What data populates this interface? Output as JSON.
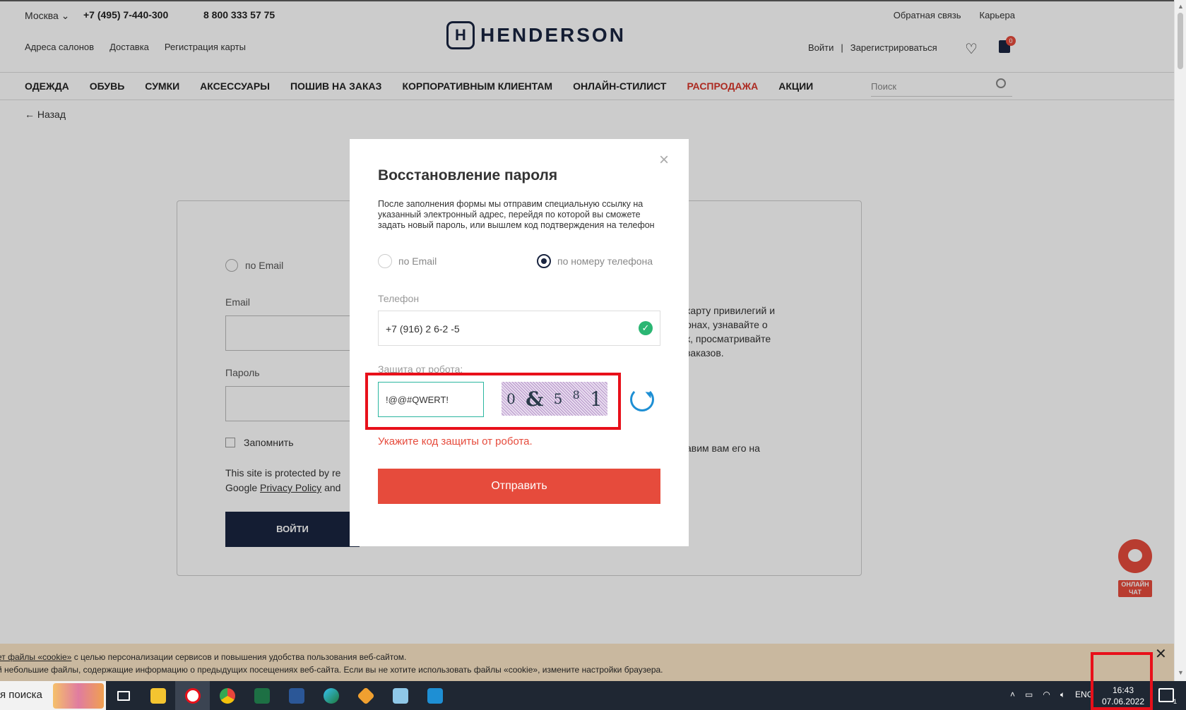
{
  "topbar": {
    "city": "Москва",
    "phone1": "+7 (495) 7-440-300",
    "phone2": "8 800 333 57 75",
    "links": [
      "Адреса салонов",
      "Доставка",
      "Регистрация карты"
    ],
    "right_links": [
      "Обратная связь",
      "Карьера"
    ],
    "logo_mark": "H",
    "logo_text": "HENDERSON",
    "login": "Войти",
    "register": "Зарегистрироваться",
    "cart_count": "0"
  },
  "nav": {
    "items": [
      "ОДЕЖДА",
      "ОБУВЬ",
      "СУМКИ",
      "АКСЕССУАРЫ",
      "ПОШИВ НА ЗАКАЗ",
      "КОРПОРАТИВНЫМ КЛИЕНТАМ",
      "ОНЛАЙН-СТИЛИСТ",
      "РАСПРОДАЖА",
      "АКЦИИ"
    ],
    "search_placeholder": "Поиск"
  },
  "back_label": "Назад",
  "login_card": {
    "radio_email": "по Email",
    "email_label": "Email",
    "password_label": "Пароль",
    "remember": "Запомнить",
    "recaptcha_line1": "This site is protected by re",
    "recaptcha_line2_pre": "Google ",
    "recaptcha_link": "Privacy Policy",
    "recaptcha_line2_post": " and",
    "submit": "ВОЙТИ",
    "side_text_lines": [
      "карту привилегий и",
      "онах, узнавайте о",
      "к, просматривайте",
      "заказов."
    ],
    "side_text2": "авим вам его на"
  },
  "modal": {
    "title": "Восстановление пароля",
    "description": "После заполнения формы мы отправим специальную ссылку на указанный электронный адрес, перейдя по которой вы сможете задать новый пароль, или вышлем код подтверждения на телефон",
    "option_email": "по Email",
    "option_phone": "по номеру телефона",
    "phone_label": "Телефон",
    "phone_value": "+7 (916) 2  6-2  -5",
    "captcha_label": "Защита от робота:",
    "captcha_value": "!@@#QWERT!",
    "captcha_chars": [
      "0",
      "&",
      "5",
      "8",
      "1"
    ],
    "error": "Укажите код защиты от робота.",
    "submit": "Отправить"
  },
  "chat": {
    "label": "ОНЛАЙН ЧАТ"
  },
  "cookie": {
    "line1_link": "ет файлы «cookie»",
    "line1": " с целью персонализации сервисов и повышения удобства пользования веб-сайтом.",
    "line2": "й небольшие файлы, содержащие информацию о предыдущих посещениях веб-сайта. Если вы не хотите использовать файлы «cookie», измените настройки браузера."
  },
  "taskbar": {
    "search_text": "я поиска",
    "apps": [
      "task-view-icon",
      "file-explorer-icon",
      "yandex-browser-icon",
      "chrome-icon",
      "excel-icon",
      "word-icon",
      "edge-icon",
      "git-icon",
      "notepad-icon",
      "vscode-icon"
    ],
    "lang": "ENG",
    "time": "16:43",
    "date": "07.06.2022",
    "notifications": "1"
  }
}
